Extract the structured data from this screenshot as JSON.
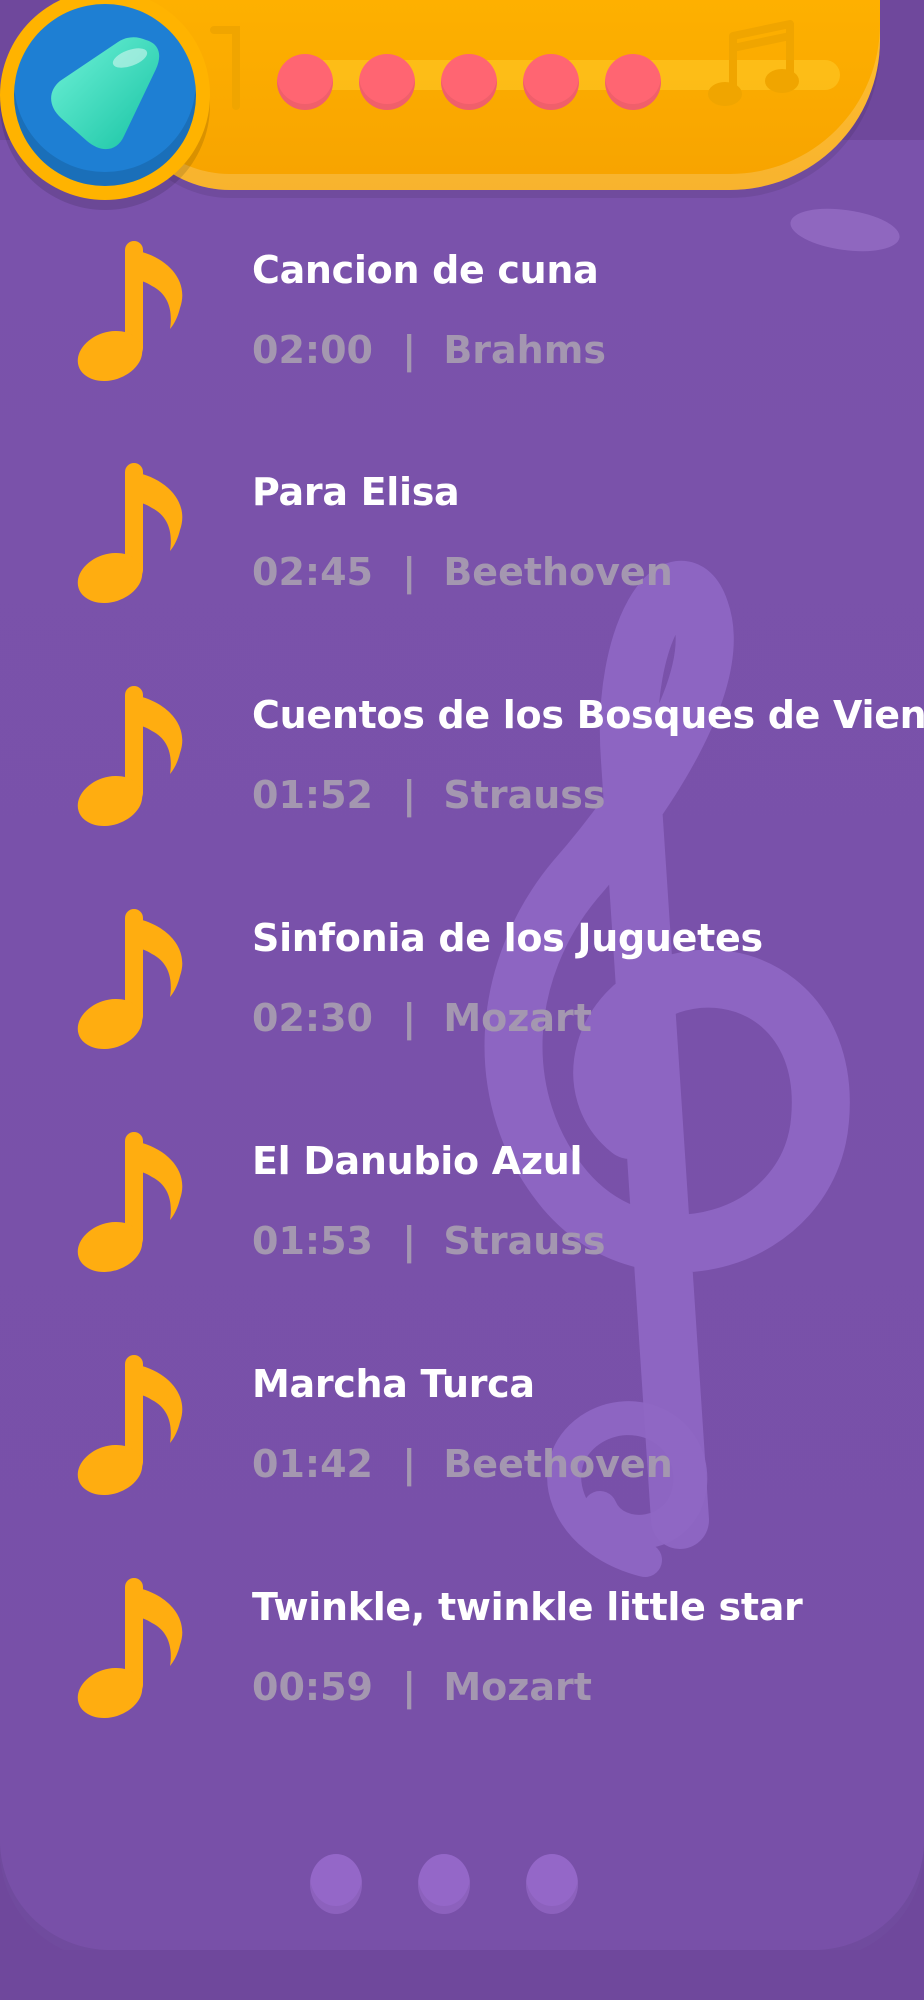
{
  "header": {
    "progress_dots": [
      "dot-1",
      "dot-2",
      "dot-3",
      "dot-4",
      "dot-5"
    ],
    "back_icon": "play-triangle-icon",
    "decor_icon": "music-note-icon"
  },
  "songs": [
    {
      "title": "Cancion de cuna",
      "duration": "02:00",
      "separator": "|",
      "composer": "Brahms"
    },
    {
      "title": "Para Elisa",
      "duration": "02:45",
      "separator": "|",
      "composer": "Beethoven"
    },
    {
      "title": "Cuentos de los Bosques de Viena",
      "duration": "01:52",
      "separator": "|",
      "composer": "Strauss"
    },
    {
      "title": "Sinfonia de los Juguetes",
      "duration": "02:30",
      "separator": "|",
      "composer": "Mozart"
    },
    {
      "title": "El Danubio Azul",
      "duration": "01:53",
      "separator": "|",
      "composer": "Strauss"
    },
    {
      "title": "Marcha Turca",
      "duration": "01:42",
      "separator": "|",
      "composer": "Beethoven"
    },
    {
      "title": "Twinkle, twinkle little star",
      "duration": "00:59",
      "separator": "|",
      "composer": "Mozart"
    }
  ],
  "pager": {
    "dots": [
      "page-1",
      "page-2",
      "page-3"
    ]
  },
  "colors": {
    "background": "#6f489c",
    "panel": "#7a52ab",
    "accent": "#ffb300",
    "dot": "#ff6572",
    "meta_text": "#a497b0",
    "title_text": "#ffffff"
  }
}
